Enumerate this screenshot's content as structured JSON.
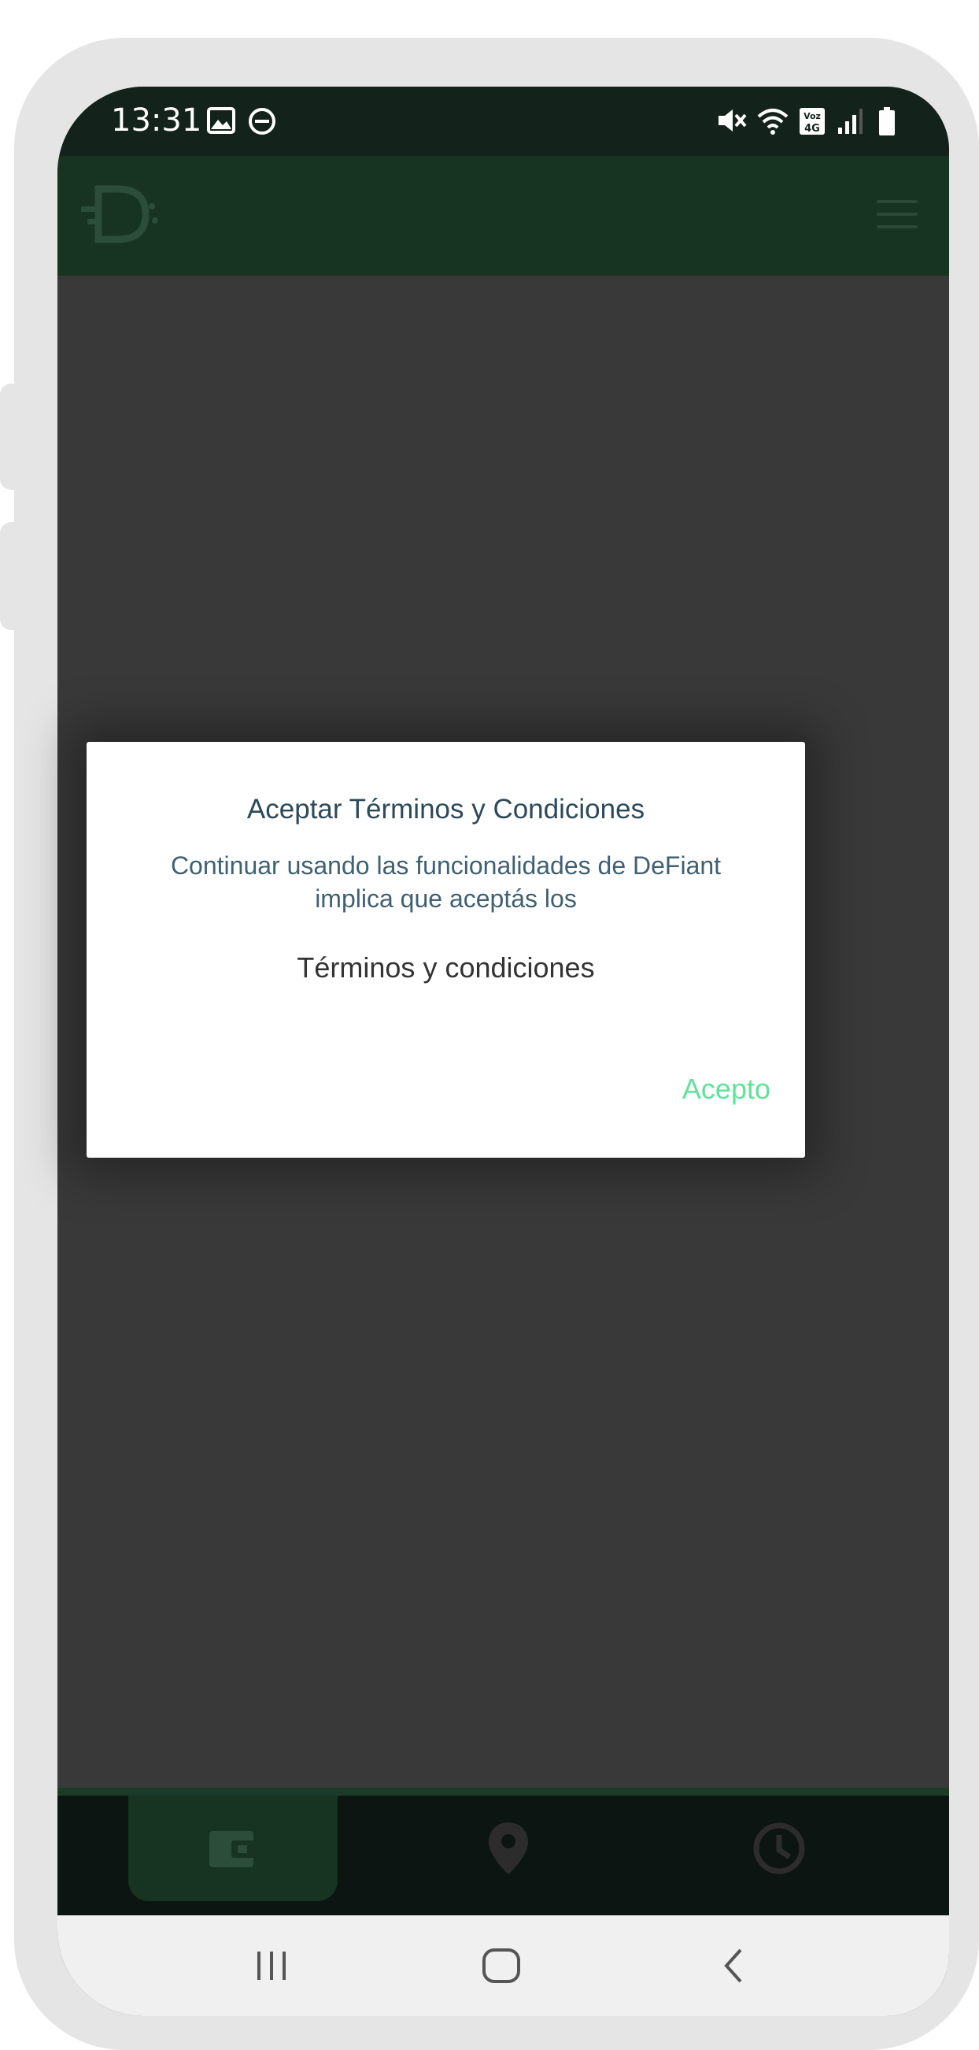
{
  "status_bar": {
    "time": "13:31",
    "left_icons": [
      "image-icon",
      "do-not-disturb-icon"
    ],
    "right_icons": [
      "mute-icon",
      "wifi-icon",
      "volte-4g-icon",
      "signal-icon",
      "battery-icon"
    ]
  },
  "header": {
    "logo": "defiant-logo",
    "menu_icon": "hamburger-menu-icon"
  },
  "dialog": {
    "title": "Aceptar Términos y Condiciones",
    "message": "Continuar usando las funcionalidades de DeFiant implica que aceptás los",
    "link_label": "Términos y condiciones",
    "accept_label": "Acepto"
  },
  "bottom_nav": {
    "items": [
      {
        "icon": "wallet-icon",
        "active": true
      },
      {
        "icon": "location-pin-icon",
        "active": false
      },
      {
        "icon": "clock-history-icon",
        "active": false
      }
    ]
  },
  "system_nav": {
    "items": [
      "recent-apps-icon",
      "home-icon",
      "back-icon"
    ]
  },
  "colors": {
    "header_bg": "#173322",
    "status_bg": "#13231b",
    "overlay_bg": "#393939",
    "accept": "#5ee39c",
    "nav_bg": "#0c1512"
  }
}
